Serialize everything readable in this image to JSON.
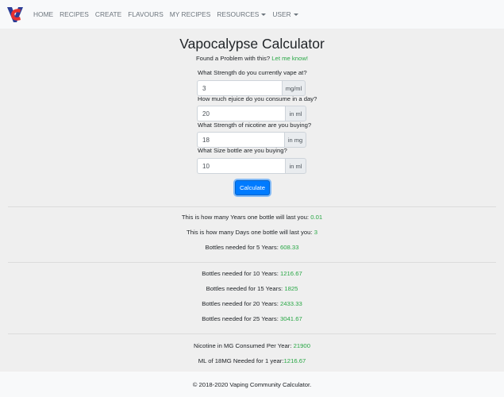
{
  "nav": {
    "items": [
      {
        "label": "HOME"
      },
      {
        "label": "RECIPES"
      },
      {
        "label": "CREATE"
      },
      {
        "label": "FLAVOURS"
      },
      {
        "label": "MY RECIPES"
      },
      {
        "label": "RESOURCES",
        "dropdown": true
      },
      {
        "label": "USER",
        "dropdown": true
      }
    ]
  },
  "page": {
    "title": "Vapocalypse Calculator",
    "problem_text": "Found a Problem with this? ",
    "problem_link": "Let me know!"
  },
  "form": {
    "strength_label": "What Strength do you currently vape at?",
    "strength_value": "3",
    "strength_unit": "mg/ml",
    "consume_label": "How much ejuice do you consume in a day?",
    "consume_value": "20",
    "consume_unit": "in ml",
    "nicotine_label": "What Strength of nicotine are you buying?",
    "nicotine_value": "18",
    "nicotine_unit": "in mg",
    "bottle_label": "What Size bottle are you buying?",
    "bottle_value": "10",
    "bottle_unit": "in ml",
    "calculate_label": "Calculate"
  },
  "results": {
    "years_label": "This is how many Years one bottle will last you: ",
    "years_value": "0.01",
    "days_label": "This is how many Days one bottle will last you: ",
    "days_value": "3",
    "b5_label": "Bottles needed for 5 Years: ",
    "b5_value": "608.33",
    "b10_label": "Bottles needed for 10 Years: ",
    "b10_value": "1216.67",
    "b15_label": "Bottles needed for 15 Years: ",
    "b15_value": "1825",
    "b20_label": "Bottles needed for 20 Years: ",
    "b20_value": "2433.33",
    "b25_label": "Bottles needed for 25 Years: ",
    "b25_value": "3041.67",
    "nic_label": "Nicotine in MG Consumed Per Year: ",
    "nic_value": "21900",
    "ml_label": "ML of 18MG Needed for 1 year:",
    "ml_value": "1216.67"
  },
  "footer": {
    "text": "© 2018-2020 Vaping Community Calculator."
  },
  "colors": {
    "accent": "#007bff",
    "value_green": "#28a745",
    "logo_red": "#e8312f",
    "logo_blue": "#2c3e97"
  }
}
